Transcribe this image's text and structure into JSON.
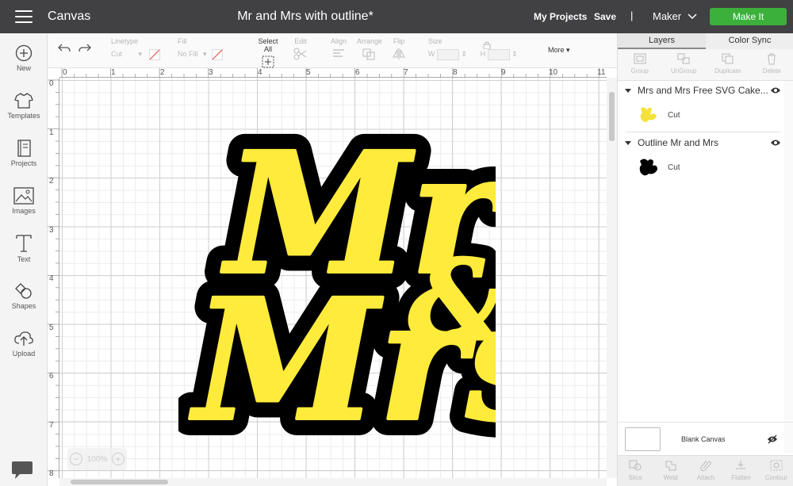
{
  "header": {
    "app_name": "Canvas",
    "doc_title": "Mr and Mrs with outline*",
    "my_projects": "My Projects",
    "save": "Save",
    "separator": "|",
    "machine": "Maker",
    "make_it": "Make It"
  },
  "sidebar": {
    "items": [
      {
        "label": "New",
        "icon": "plus-circle-icon"
      },
      {
        "label": "Templates",
        "icon": "shirt-icon"
      },
      {
        "label": "Projects",
        "icon": "book-icon"
      },
      {
        "label": "Images",
        "icon": "image-icon"
      },
      {
        "label": "Text",
        "icon": "text-icon"
      },
      {
        "label": "Shapes",
        "icon": "shapes-icon"
      },
      {
        "label": "Upload",
        "icon": "upload-cloud-icon"
      }
    ]
  },
  "toolbar": {
    "linetype_label": "Linetype",
    "linetype_value": "Cut",
    "fill_label": "Fill",
    "fill_value": "No Fill",
    "select_all": "Select All",
    "edit": "Edit",
    "align": "Align",
    "arrange": "Arrange",
    "flip": "Flip",
    "size": "Size",
    "w": "W",
    "h": "H",
    "more": "More"
  },
  "ruler": {
    "top": [
      "0",
      "1",
      "2",
      "3",
      "4",
      "5",
      "6",
      "7",
      "8",
      "9",
      "10",
      "11"
    ],
    "left": [
      "0",
      "1",
      "2",
      "3",
      "4",
      "5",
      "6",
      "7",
      "8"
    ]
  },
  "design": {
    "line1": "Mr",
    "line2": "Mrs",
    "ampersand": "&",
    "fill_color": "#ffeb3b",
    "outline_color": "#000000"
  },
  "zoom": {
    "value": "100%",
    "minus": "−",
    "plus": "+"
  },
  "panel": {
    "tabs": [
      "Layers",
      "Color Sync"
    ],
    "actions": [
      "Group",
      "UnGroup",
      "Duplicate",
      "Delete"
    ],
    "layers": [
      {
        "name": "Mrs and Mrs Free SVG Cake...",
        "child": "Cut",
        "color": "#f5e13a"
      },
      {
        "name": "Outline Mr and Mrs",
        "child": "Cut",
        "color": "#000000"
      }
    ],
    "blank_canvas": "Blank Canvas",
    "bottom_actions": [
      "Slice",
      "Weld",
      "Attach",
      "Flatten",
      "Contour"
    ]
  }
}
